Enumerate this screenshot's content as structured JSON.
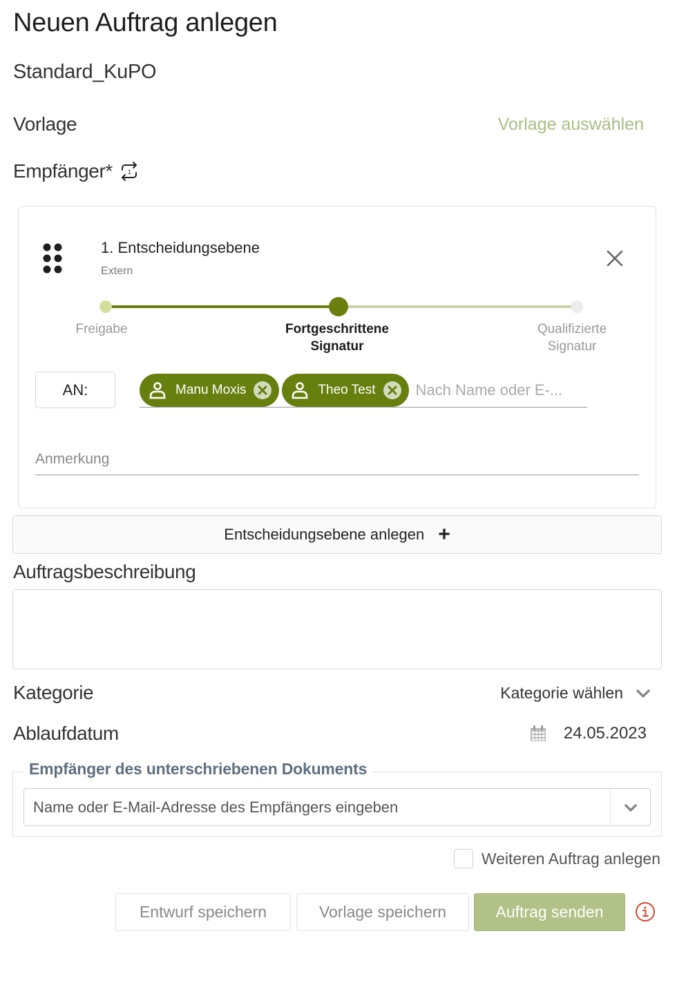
{
  "header": {
    "title": "Neuen Auftrag anlegen",
    "subtitle": "Standard_KuPO"
  },
  "template": {
    "label": "Vorlage",
    "select_link": "Vorlage auswählen"
  },
  "recipients": {
    "label": "Empfänger*",
    "order_icon": "sequence-swap-icon",
    "levels": [
      {
        "title": "1. Entscheidungsebene",
        "type": "Extern",
        "signature_steps": [
          {
            "label": "Freigabe",
            "state": "done"
          },
          {
            "label": "Fortgeschrittene Signatur",
            "state": "active"
          },
          {
            "label": "Qualifizierte Signatur",
            "state": "inactive"
          }
        ],
        "to_label": "AN:",
        "chips": [
          {
            "name": "Manu Moxis",
            "icon": "person-icon"
          },
          {
            "name": "Theo Test",
            "icon": "person-icon"
          }
        ],
        "search_placeholder": "Nach Name oder E-...",
        "note_placeholder": "Anmerkung"
      }
    ],
    "add_level_label": "Entscheidungsebene anlegen",
    "add_level_icon": "+"
  },
  "description": {
    "label": "Auftragsbeschreibung",
    "value": ""
  },
  "category": {
    "label": "Kategorie",
    "placeholder": "Kategorie wählen"
  },
  "expiry": {
    "label": "Ablaufdatum",
    "value": "24.05.2023"
  },
  "signed_doc_recipients": {
    "legend": "Empfänger des unterschriebenen Dokuments",
    "placeholder": "Name oder E-Mail-Adresse des Empfängers eingeben"
  },
  "another_order": {
    "label": "Weiteren Auftrag anlegen",
    "checked": false
  },
  "actions": {
    "save_draft": "Entwurf speichern",
    "save_template": "Vorlage speichern",
    "send": "Auftrag senden"
  },
  "colors": {
    "primary": "#677f0e",
    "primary_light": "#b1c187",
    "link": "#a9bd85",
    "warning": "#d9442e"
  }
}
